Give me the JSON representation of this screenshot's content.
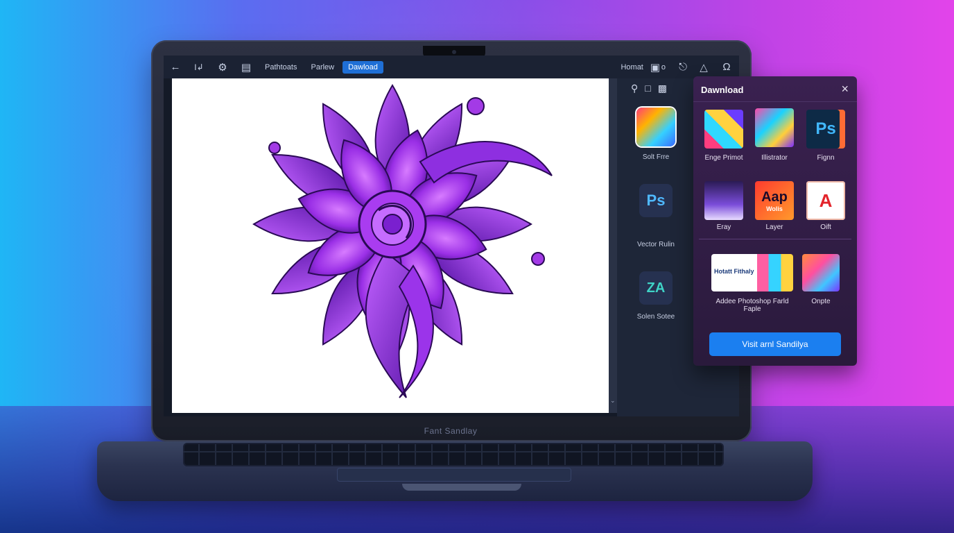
{
  "toolbar": {
    "tabs": [
      {
        "label": "Pathtoats"
      },
      {
        "label": "Parlew"
      },
      {
        "label": "Dawload"
      }
    ],
    "right_label": "Homat",
    "right_mini": "o"
  },
  "side_panel": {
    "apps": [
      {
        "label": "Solt Frre",
        "icon": "gradient-app-icon"
      },
      {
        "label": "Vector Rulin",
        "icon": "ps-icon",
        "badge": "Ps"
      },
      {
        "label": "Solen Sotee",
        "icon": "za-icon",
        "badge": "ZA"
      }
    ]
  },
  "popup": {
    "title": "Dawnload",
    "items_row1": [
      {
        "label": "Enge Primot",
        "icon": "collage-icon"
      },
      {
        "label": "Illistrator",
        "icon": "illustrator-collage-icon"
      },
      {
        "label": "Fignn",
        "icon": "ps-icon",
        "badge": "Ps"
      }
    ],
    "items_row2": [
      {
        "label": "Eray",
        "icon": "mountain-icon"
      },
      {
        "label": "Layer",
        "icon": "aap-icon",
        "badge": "Aap",
        "sub": "Wolis"
      },
      {
        "label": "Oift",
        "icon": "acrobat-icon",
        "badge": "A"
      }
    ],
    "bottom_items": [
      {
        "label": "Addee Photoshop Farld Faple",
        "icon": "photoshop-banner-icon",
        "banner_text": "Hotatt Fithaly"
      },
      {
        "label": "Onpte",
        "icon": "photo-collage-icon"
      }
    ],
    "visit_button": "Visit arnl Sandilya"
  },
  "laptop": {
    "brand": "Fant Sandlay"
  },
  "colors": {
    "accent": "#1b7ff0",
    "popup_bg": "#2a1a3c",
    "art_purple": "#8a2be2"
  }
}
